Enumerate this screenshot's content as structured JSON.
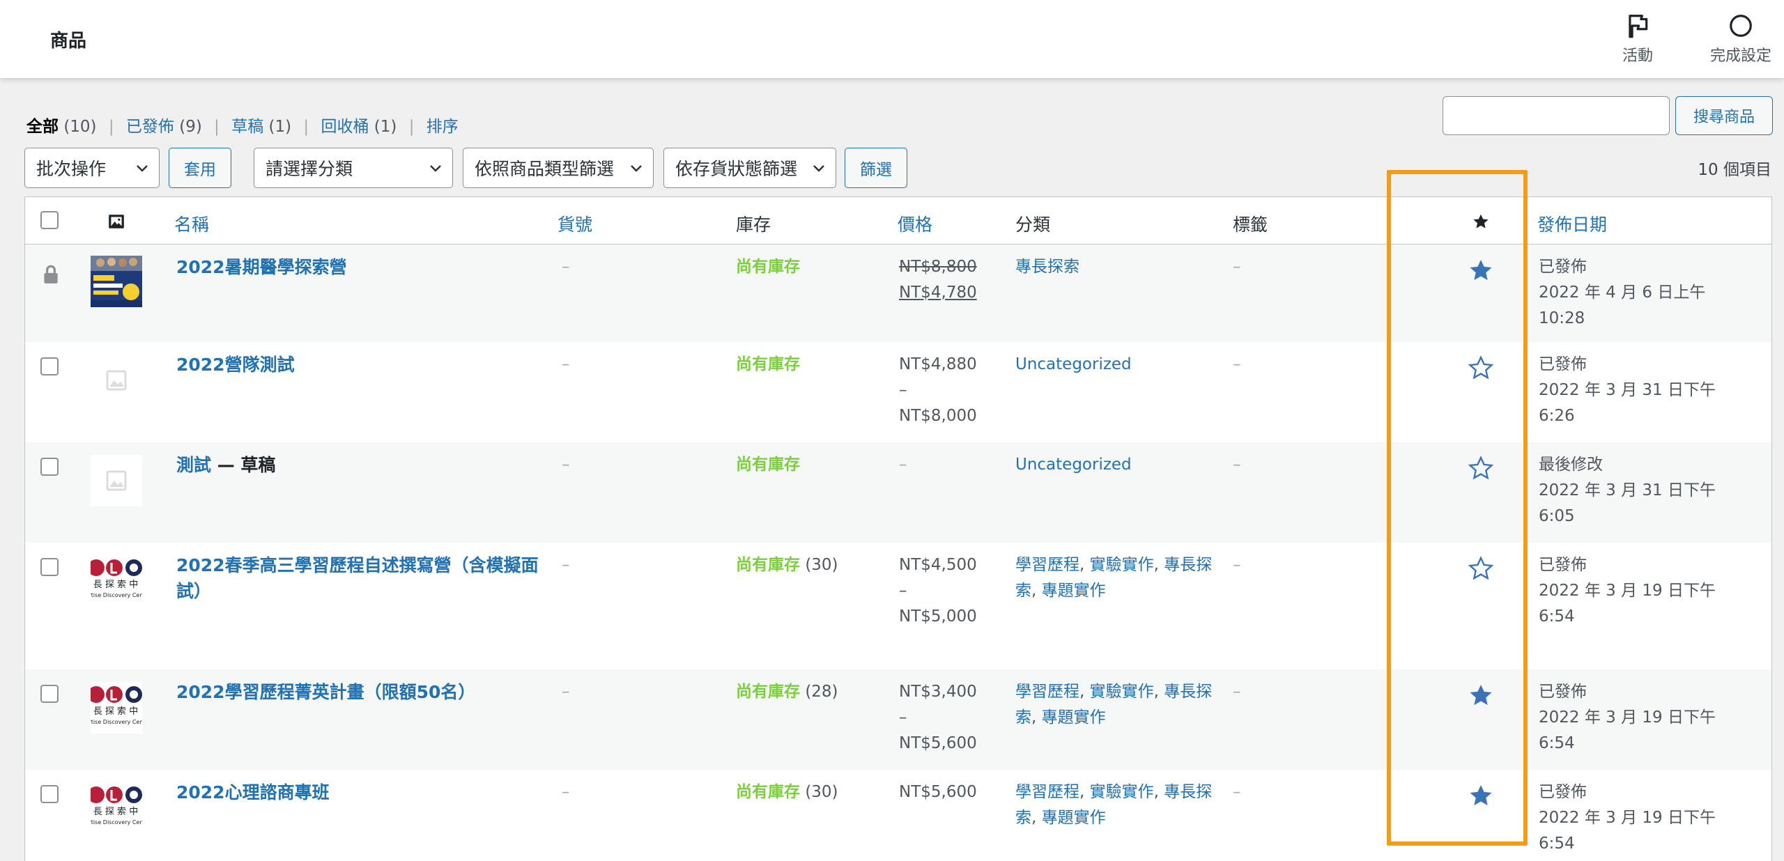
{
  "header": {
    "title": "商品",
    "actions": [
      {
        "label": "活動",
        "icon": "flag-icon"
      },
      {
        "label": "完成設定",
        "icon": "circle-icon"
      }
    ]
  },
  "views": [
    {
      "label": "全部",
      "count": "(10)",
      "current": true
    },
    {
      "label": "已發佈",
      "count": "(9)"
    },
    {
      "label": "草稿",
      "count": "(1)"
    },
    {
      "label": "回收桶",
      "count": "(1)"
    },
    {
      "label": "排序",
      "count": ""
    }
  ],
  "search": {
    "placeholder": "",
    "button": "搜尋商品"
  },
  "toolbar": {
    "bulk_action": "批次操作",
    "apply": "套用",
    "category_filter": "請選擇分類",
    "type_filter": "依照商品類型篩選",
    "stock_filter": "依存貨狀態篩選",
    "filter": "篩選",
    "items_count": "10 個項目"
  },
  "columns": {
    "name": "名稱",
    "sku": "貨號",
    "stock": "庫存",
    "price": "價格",
    "category": "分類",
    "tags": "標籤",
    "date": "發佈日期"
  },
  "rows": [
    {
      "name": "2022暑期醫學探索營",
      "name_suffix": "",
      "sku": "–",
      "stock": "尚有庫存",
      "stock_count": "",
      "price_lines": [
        "NT$8,800",
        "NT$4,780"
      ],
      "categories": [
        "專長探索"
      ],
      "tags": "–",
      "featured": true,
      "date_status": "已發佈",
      "date_lines": [
        "2022 年 4 月 6 日上午",
        "10:28"
      ],
      "thumb": "photo",
      "locked": true
    },
    {
      "name": "2022營隊測試",
      "name_suffix": "",
      "sku": "–",
      "stock": "尚有庫存",
      "stock_count": "",
      "price_lines": [
        "NT$4,880",
        "–",
        "NT$8,000"
      ],
      "categories": [
        "Uncategorized"
      ],
      "tags": "–",
      "featured": false,
      "date_status": "已發佈",
      "date_lines": [
        "2022 年 3 月 31 日下午",
        "6:26"
      ],
      "thumb": "placeholder",
      "locked": false
    },
    {
      "name": "測試",
      "name_suffix": " — 草稿",
      "sku": "–",
      "stock": "尚有庫存",
      "stock_count": "",
      "price_lines": [
        "–"
      ],
      "categories": [
        "Uncategorized"
      ],
      "tags": "–",
      "featured": false,
      "date_status": "最後修改",
      "date_lines": [
        "2022 年 3 月 31 日下午",
        "6:05"
      ],
      "thumb": "placeholder",
      "locked": false
    },
    {
      "name": "2022春季高三學習歷程自述撰寫營（含模擬面試）",
      "name_suffix": "",
      "sku": "–",
      "stock": "尚有庫存",
      "stock_count": "(30)",
      "price_lines": [
        "NT$4,500",
        "–",
        "NT$5,000"
      ],
      "categories": [
        "學習歷程",
        "實驗實作",
        "專長探索",
        "專題實作"
      ],
      "tags": "–",
      "featured": false,
      "date_status": "已發佈",
      "date_lines": [
        "2022 年 3 月 19 日下午",
        "6:54"
      ],
      "thumb": "logo",
      "locked": false
    },
    {
      "name": "2022學習歷程菁英計畫（限額50名）",
      "name_suffix": "",
      "sku": "–",
      "stock": "尚有庫存",
      "stock_count": "(28)",
      "price_lines": [
        "NT$3,400",
        "–",
        "NT$5,600"
      ],
      "categories": [
        "學習歷程",
        "實驗實作",
        "專長探索",
        "專題實作"
      ],
      "tags": "–",
      "featured": true,
      "date_status": "已發佈",
      "date_lines": [
        "2022 年 3 月 19 日下午",
        "6:54"
      ],
      "thumb": "logo",
      "locked": false
    },
    {
      "name": "2022心理諮商專班",
      "name_suffix": "",
      "sku": "–",
      "stock": "尚有庫存",
      "stock_count": "(30)",
      "price_lines": [
        "NT$5,600"
      ],
      "categories": [
        "學習歷程",
        "實驗實作",
        "專長探索",
        "專題實作"
      ],
      "tags": "–",
      "featured": true,
      "date_status": "已發佈",
      "date_lines": [
        "2022 年 3 月 19 日下午",
        "6:54"
      ],
      "thumb": "logo",
      "locked": false
    }
  ],
  "logo_text": {
    "line1": "長 探 索 中",
    "line2": "ertise Discovery Cen"
  },
  "colors": {
    "link": "#2271b1",
    "in_stock": "#7ad03a",
    "highlight": "#f29d1a",
    "star": "#3a73b8"
  }
}
